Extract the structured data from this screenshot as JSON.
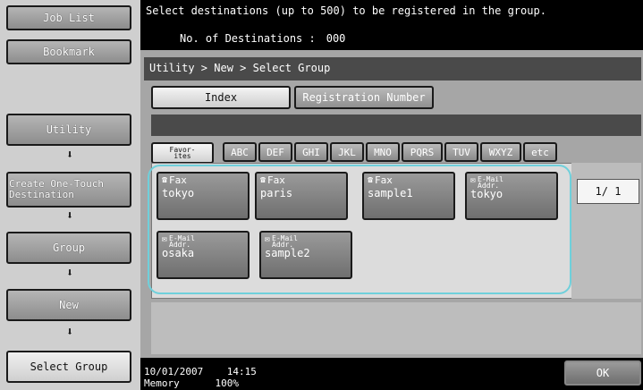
{
  "sidebar": {
    "job_list": "Job List",
    "bookmark": "Bookmark",
    "steps": [
      "Utility",
      "Create One-Touch Destination",
      "Group",
      "New",
      "Select Group"
    ],
    "arrow": "⬇"
  },
  "header": {
    "message": "Select destinations (up to 500) to be registered in the group.",
    "count_label": "No. of Destinations :",
    "count_value": "000"
  },
  "breadcrumb": "Utility > New > Select Group",
  "tabs": {
    "index": "Index",
    "registration_number": "Registration Number"
  },
  "index_keys": {
    "favorites_line1": "Favor-",
    "favorites_line2": "ites",
    "keys": [
      "ABC",
      "DEF",
      "GHI",
      "JKL",
      "MNO",
      "PQRS",
      "TUV",
      "WXYZ",
      "etc"
    ]
  },
  "destinations": [
    {
      "type": "Fax",
      "type_line2": "",
      "name": "tokyo",
      "icon": "fax-icon"
    },
    {
      "type": "Fax",
      "type_line2": "",
      "name": "paris",
      "icon": "fax-icon"
    },
    {
      "type": "Fax",
      "type_line2": "",
      "name": "sample1",
      "icon": "fax-icon"
    },
    {
      "type": "E-Mail",
      "type_line2": "Addr.",
      "name": "tokyo",
      "icon": "email-icon"
    },
    {
      "type": "E-Mail",
      "type_line2": "Addr.",
      "name": "osaka",
      "icon": "email-icon"
    },
    {
      "type": "E-Mail",
      "type_line2": "Addr.",
      "name": "sample2",
      "icon": "email-icon"
    }
  ],
  "page": {
    "indicator": "1/  1"
  },
  "status": {
    "date": "10/01/2007",
    "time": "14:15",
    "memory_label": "Memory",
    "memory_value": "100%"
  },
  "ok_label": "OK",
  "colors": {
    "highlight": "#6fd0db",
    "panel": "#a6a6a6",
    "background": "#000000"
  }
}
